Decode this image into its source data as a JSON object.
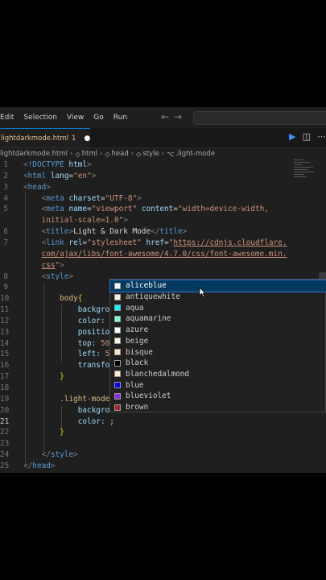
{
  "menu": [
    "Edit",
    "Selection",
    "View",
    "Go",
    "Run"
  ],
  "nav": {
    "back": "←",
    "forward": "→"
  },
  "tab": {
    "filename": "lightdarkmode.html",
    "modified_count": "1",
    "dot": "●"
  },
  "breadcrumb": {
    "file": "lightdarkmode.html",
    "items": [
      "html",
      "head",
      "style",
      ".light-mode"
    ]
  },
  "lines": [
    {
      "n": "1",
      "html": "<span class='bracket'>&lt;</span><span class='doc'>!DOCTYPE</span> <span class='attr'>html</span><span class='bracket'>&gt;</span>"
    },
    {
      "n": "2",
      "html": "<span class='bracket'>&lt;</span><span class='tag'>html</span> <span class='attr'>lang</span><span class='plain'>=</span><span class='str'>\"en\"</span><span class='bracket'>&gt;</span>"
    },
    {
      "n": "3",
      "html": "<span class='bracket'>&lt;</span><span class='tag'>head</span><span class='bracket'>&gt;</span>"
    },
    {
      "n": "4",
      "html": "    <span class='bracket'>&lt;</span><span class='tag'>meta</span> <span class='attr'>charset</span><span class='plain'>=</span><span class='str'>\"UTF-8\"</span><span class='bracket'>&gt;</span>"
    },
    {
      "n": "5",
      "html": "    <span class='bracket'>&lt;</span><span class='tag'>meta</span> <span class='attr'>name</span><span class='plain'>=</span><span class='str'>\"viewport\"</span> <span class='attr'>content</span><span class='plain'>=</span><span class='str'>\"width=device-width,</span>"
    },
    {
      "n": "",
      "html": "    <span class='str'>initial-scale=1.0\"</span><span class='bracket'>&gt;</span>"
    },
    {
      "n": "6",
      "html": "    <span class='bracket'>&lt;</span><span class='tag'>title</span><span class='bracket'>&gt;</span><span class='plain'>Light &amp; Dark Mode</span><span class='bracket'>&lt;/</span><span class='tag'>title</span><span class='bracket'>&gt;</span>"
    },
    {
      "n": "7",
      "html": "    <span class='bracket'>&lt;</span><span class='tag'>link</span> <span class='attr'>rel</span><span class='plain'>=</span><span class='str'>\"stylesheet\"</span> <span class='attr'>href</span><span class='plain'>=</span><span class='str'>\"</span><span class='url'>https://cdnjs.cloudflare.</span>"
    },
    {
      "n": "",
      "html": "    <span class='url'>com/ajax/libs/font-awesome/4.7.0/css/font-awesome.min.</span>"
    },
    {
      "n": "",
      "html": "    <span class='url'>css</span><span class='str'>\"</span><span class='bracket'>&gt;</span>"
    },
    {
      "n": "8",
      "html": "    <span class='bracket'>&lt;</span><span class='tag'>style</span><span class='bracket'>&gt;</span>"
    },
    {
      "n": "9",
      "html": ""
    },
    {
      "n": "10",
      "html": "        <span class='sel'>body</span><span class='brace'>{</span>"
    },
    {
      "n": "11",
      "html": "            <span class='prop'>backgro</span>"
    },
    {
      "n": "12",
      "html": "            <span class='prop'>color:</span>"
    },
    {
      "n": "13",
      "html": "            <span class='prop'>positio</span>"
    },
    {
      "n": "14",
      "html": "            <span class='prop'>top:</span> <span class='str'>50</span>"
    },
    {
      "n": "15",
      "html": "            <span class='prop'>left:</span> <span class='str'>5</span>"
    },
    {
      "n": "16",
      "html": "            <span class='prop'>transfo</span>"
    },
    {
      "n": "17",
      "html": "        <span class='brace'>}</span>"
    },
    {
      "n": "18",
      "html": ""
    },
    {
      "n": "19",
      "html": "        <span class='sel'>.light-mode</span>"
    },
    {
      "n": "20",
      "html": "            <span class='prop'>backgro</span>"
    },
    {
      "n": "21",
      "html": "            <span class='prop'>color:</span> <span class='plain'>;</span>"
    },
    {
      "n": "22",
      "html": "        <span class='brace'>}</span>"
    },
    {
      "n": "23",
      "html": ""
    },
    {
      "n": "24",
      "html": "    <span class='bracket'>&lt;/</span><span class='tag'>style</span><span class='bracket'>&gt;</span>"
    },
    {
      "n": "25",
      "html": "<span class='bracket'>&lt;/</span><span class='tag'>head</span><span class='bracket'>&gt;</span>"
    }
  ],
  "active_line": "21",
  "suggestions": [
    {
      "label": "aliceblue",
      "color": "#f0f8ff",
      "selected": true
    },
    {
      "label": "antiquewhite",
      "color": "#faebd7"
    },
    {
      "label": "aqua",
      "color": "#00ffff"
    },
    {
      "label": "aquamarine",
      "color": "#7fffd4"
    },
    {
      "label": "azure",
      "color": "#f0ffff"
    },
    {
      "label": "beige",
      "color": "#f5f5dc"
    },
    {
      "label": "bisque",
      "color": "#ffe4c4"
    },
    {
      "label": "black",
      "color": "#000000"
    },
    {
      "label": "blanchedalmond",
      "color": "#ffebcd"
    },
    {
      "label": "blue",
      "color": "#0000ff"
    },
    {
      "label": "blueviolet",
      "color": "#8a2be2"
    },
    {
      "label": "brown",
      "color": "#a52a2a"
    }
  ]
}
